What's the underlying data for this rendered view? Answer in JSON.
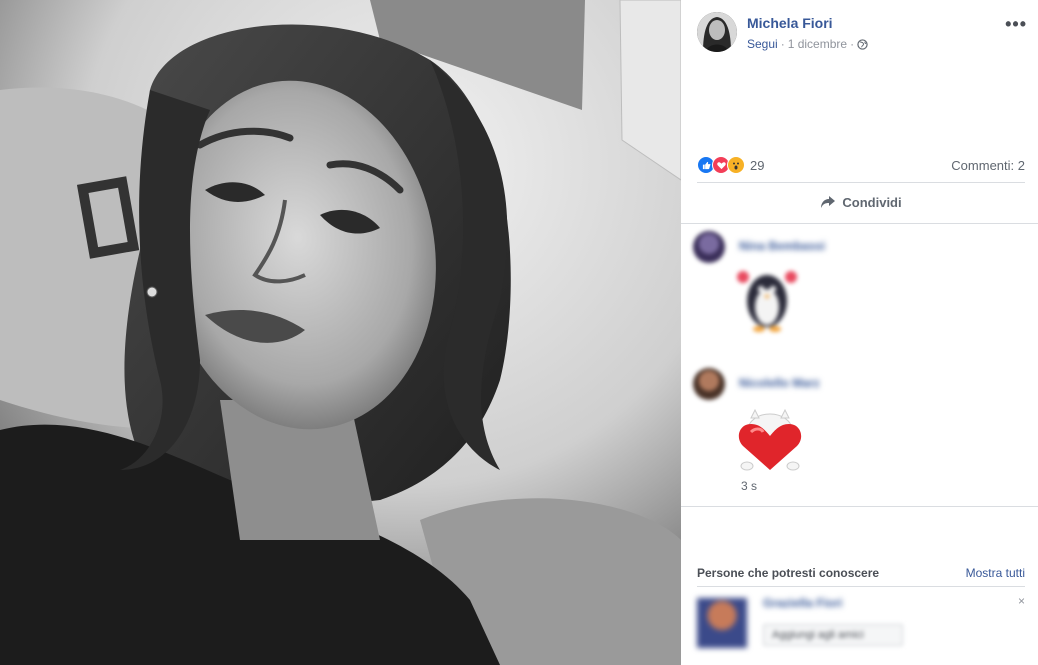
{
  "post": {
    "author_name": "Michela Fiori",
    "follow_label": "Segui",
    "separator": "·",
    "date": "1 dicembre",
    "more_label": "•••"
  },
  "reactions": {
    "count": "29",
    "comments_label": "Commenti: 2",
    "types": [
      "like-icon",
      "love-icon",
      "wow-icon"
    ],
    "colors": {
      "like": "#1877f2",
      "love": "#f33e58",
      "wow": "#f7b125"
    }
  },
  "actions": {
    "share_label": "Condividi"
  },
  "comments": [
    {
      "name": "Nina Bembassi",
      "time": ""
    },
    {
      "name": "Nicolello Marz",
      "time": "3 s"
    }
  ],
  "suggestions": {
    "title": "Persone che potresti conoscere",
    "show_all_label": "Mostra tutti",
    "items": [
      {
        "name": "Graziella Fiori",
        "button_label": "Aggiungi agli amici",
        "close_label": "×"
      }
    ]
  },
  "colors": {
    "link": "#385898",
    "muted": "#90949c",
    "divider": "#dadde1"
  }
}
